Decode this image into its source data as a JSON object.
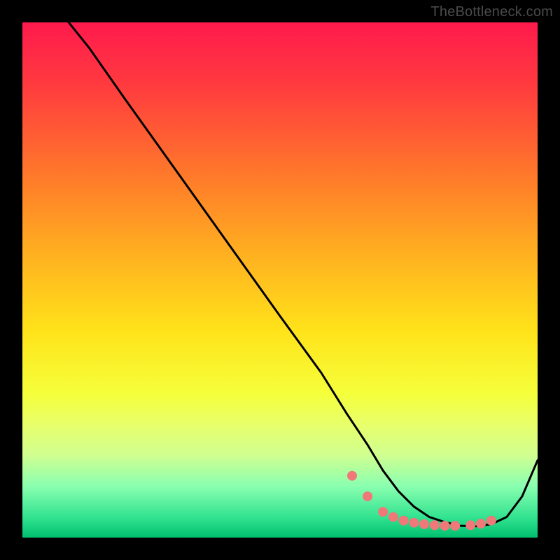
{
  "attribution": "TheBottleneck.com",
  "chart_data": {
    "type": "line",
    "title": "",
    "xlabel": "",
    "ylabel": "",
    "xlim": [
      0,
      100
    ],
    "ylim": [
      0,
      100
    ],
    "series": [
      {
        "name": "curve",
        "x": [
          0,
          9,
          13,
          20,
          30,
          40,
          50,
          58,
          63,
          67,
          70,
          73,
          76,
          79,
          82,
          85,
          88,
          91,
          94,
          97,
          100
        ],
        "values": [
          110,
          100,
          95,
          85,
          71,
          57,
          43,
          32,
          24,
          18,
          13,
          9,
          6,
          4,
          3,
          2.3,
          2.2,
          2.6,
          4,
          8,
          15
        ]
      }
    ],
    "markers": {
      "name": "dots",
      "x": [
        64,
        67,
        70,
        72,
        74,
        76,
        78,
        80,
        82,
        84,
        87,
        89,
        91
      ],
      "values": [
        12,
        8,
        5,
        4,
        3.3,
        2.9,
        2.6,
        2.4,
        2.3,
        2.3,
        2.4,
        2.7,
        3.3
      ],
      "color": "#f07878",
      "radius": 7
    },
    "colors": {
      "curve": "#000000",
      "background_top": "#ff1a4d",
      "background_bottom": "#00c070"
    }
  }
}
